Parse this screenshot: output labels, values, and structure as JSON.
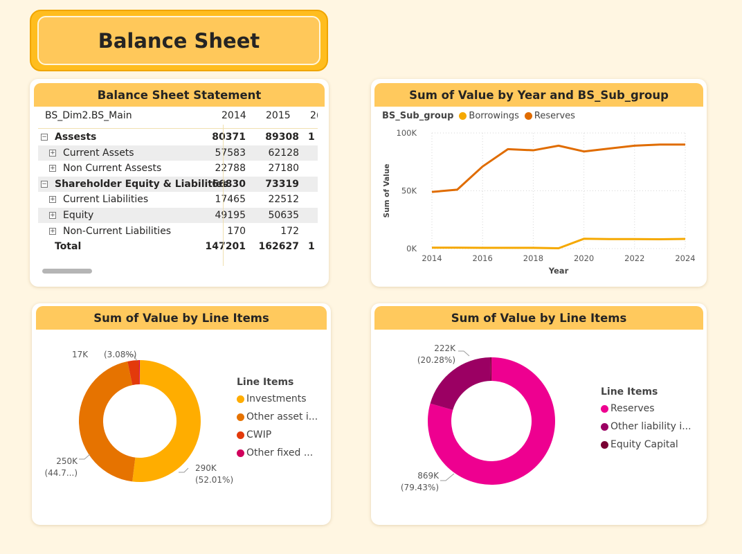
{
  "header": {
    "title": "Balance Sheet"
  },
  "table_card": {
    "title": "Balance Sheet Statement",
    "column_header": "BS_Dim2.BS_Main",
    "years": [
      "2014",
      "2015",
      "2("
    ],
    "rows": [
      {
        "label": "Assests",
        "v2014": "80371",
        "v2015": "89308",
        "v2016": "1",
        "level": 0,
        "expander": "⊟",
        "bold": true,
        "shaded": false
      },
      {
        "label": "Current Assets",
        "v2014": "57583",
        "v2015": "62128",
        "v2016": "",
        "level": 1,
        "expander": "⊞",
        "bold": false,
        "shaded": true
      },
      {
        "label": "Non Current Assests",
        "v2014": "22788",
        "v2015": "27180",
        "v2016": "",
        "level": 1,
        "expander": "⊞",
        "bold": false,
        "shaded": false
      },
      {
        "label": "Shareholder Equity & Liabilities",
        "v2014": "66830",
        "v2015": "73319",
        "v2016": "",
        "level": 0,
        "expander": "⊟",
        "bold": true,
        "shaded": true
      },
      {
        "label": "Current Liabilities",
        "v2014": "17465",
        "v2015": "22512",
        "v2016": "",
        "level": 1,
        "expander": "⊞",
        "bold": false,
        "shaded": false
      },
      {
        "label": "Equity",
        "v2014": "49195",
        "v2015": "50635",
        "v2016": "",
        "level": 1,
        "expander": "⊞",
        "bold": false,
        "shaded": true
      },
      {
        "label": "Non-Current Liabilities",
        "v2014": "170",
        "v2015": "172",
        "v2016": "",
        "level": 1,
        "expander": "⊞",
        "bold": false,
        "shaded": false
      },
      {
        "label": "Total",
        "v2014": "147201",
        "v2015": "162627",
        "v2016": "1",
        "level": 0,
        "expander": "",
        "bold": true,
        "shaded": false
      }
    ]
  },
  "line_card": {
    "title": "Sum of Value by Year and BS_Sub_group"
  },
  "donut1_card": {
    "title": "Sum of Value by Line Items"
  },
  "donut2_card": {
    "title": "Sum of Value by Line Items"
  },
  "chart_data": [
    {
      "type": "line",
      "title": "Sum of Value by Year and BS_Sub_group",
      "xlabel": "Year",
      "ylabel": "Sum of Value",
      "legend_title": "BS_Sub_group",
      "x": [
        2014,
        2015,
        2016,
        2017,
        2018,
        2019,
        2020,
        2021,
        2022,
        2023,
        2024
      ],
      "x_ticks": [
        "2014",
        "2016",
        "2018",
        "2020",
        "2022",
        "2024"
      ],
      "y_ticks": [
        "0K",
        "50K",
        "100K"
      ],
      "ylim": [
        0,
        100000
      ],
      "grid": true,
      "series": [
        {
          "name": "Borrowings",
          "color": "#f5a800",
          "values": [
            800,
            800,
            700,
            700,
            700,
            300,
            8500,
            8200,
            8200,
            8100,
            8400
          ]
        },
        {
          "name": "Reserves",
          "color": "#e06c00",
          "values": [
            49000,
            51000,
            71000,
            86000,
            85000,
            89000,
            84000,
            86500,
            89000,
            90000,
            90000
          ]
        }
      ]
    },
    {
      "type": "pie",
      "title": "Sum of Value by Line Items",
      "legend_title": "Line Items",
      "series": [
        {
          "name": "Investments",
          "value": 290000,
          "percent": 52.01,
          "color": "#ffad00"
        },
        {
          "name": "Other asset i...",
          "value": 250000,
          "percent": 44.7,
          "color": "#e67300"
        },
        {
          "name": "CWIP",
          "value": 17000,
          "percent": 3.08,
          "color": "#e33a0b"
        },
        {
          "name": "Other fixed ...",
          "value": 1200,
          "percent": 0.21,
          "color": "#d1005c"
        }
      ],
      "labels": [
        {
          "value": "17K",
          "pct": "(3.08%)"
        },
        {
          "value": "250K",
          "pct": "(44.7...)"
        },
        {
          "value": "290K",
          "pct": "(52.01%)"
        }
      ]
    },
    {
      "type": "pie",
      "title": "Sum of Value by Line Items",
      "legend_title": "Line Items",
      "series": [
        {
          "name": "Reserves",
          "value": 869000,
          "percent": 79.43,
          "color": "#ee0090"
        },
        {
          "name": "Other liability i...",
          "value": 222000,
          "percent": 20.28,
          "color": "#9b0063"
        },
        {
          "name": "Equity Capital",
          "value": 3000,
          "percent": 0.29,
          "color": "#7a0033"
        }
      ],
      "labels": [
        {
          "value": "222K",
          "pct": "(20.28%)"
        },
        {
          "value": "869K",
          "pct": "(79.43%)"
        }
      ]
    }
  ]
}
